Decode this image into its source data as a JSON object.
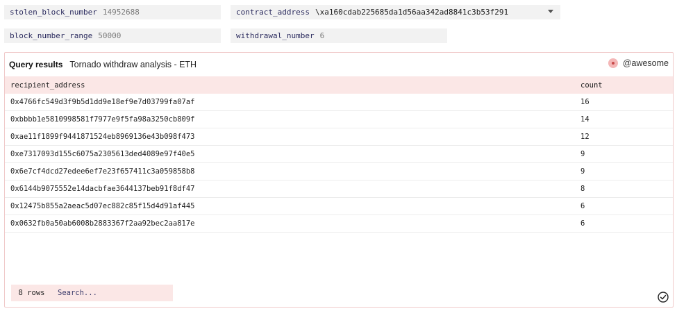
{
  "params": {
    "stolen_block_number": {
      "name": "stolen_block_number",
      "value": "14952688"
    },
    "contract_address": {
      "name": "contract_address",
      "value": "\\xa160cdab225685da1d56aa342ad8841c3b53f291"
    },
    "block_number_range": {
      "name": "block_number_range",
      "value": "50000"
    },
    "withdrawal_number": {
      "name": "withdrawal_number",
      "value": "6"
    }
  },
  "panel": {
    "label": "Query results",
    "title": "Tornado withdraw analysis - ETH",
    "user": "@awesome"
  },
  "table": {
    "columns": [
      "recipient_address",
      "count"
    ],
    "rows": [
      [
        "0x4766fc549d3f9b5d1dd9e18ef9e7d03799fa07af",
        "16"
      ],
      [
        "0xbbbb1e5810998581f7977e9f5fa98a3250cb809f",
        "14"
      ],
      [
        "0xae11f1899f9441871524eb8969136e43b098f473",
        "12"
      ],
      [
        "0xe7317093d155c6075a2305613ded4089e97f40e5",
        "9"
      ],
      [
        "0x6e7cf4dcd27edee6ef7e23f657411c3a059858b8",
        "9"
      ],
      [
        "0x6144b9075552e14dacbfae3644137beb91f8df47",
        "8"
      ],
      [
        "0x12475b855a2aeac5d07ec882c85f15d4d91af445",
        "6"
      ],
      [
        "0x0632fb0a50ab6008b2883367f2aa92bec2aa817e",
        "6"
      ]
    ]
  },
  "footer": {
    "row_count": "8 rows",
    "search_placeholder": "Search..."
  },
  "icons": {
    "dropdown": "chevron-down-icon",
    "status": "check-circle-icon",
    "avatar": "avatar-icon"
  }
}
